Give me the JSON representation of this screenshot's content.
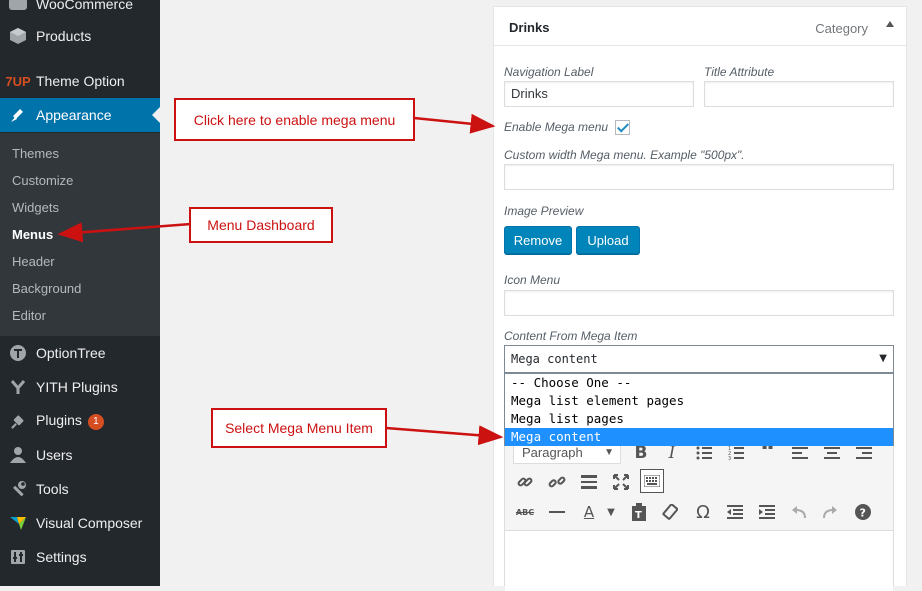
{
  "sidebar": {
    "items": [
      {
        "label": "WooCommerce",
        "icon": "woocommerce-icon"
      },
      {
        "label": "Products",
        "icon": "products-icon"
      },
      {
        "label": "Theme Option",
        "icon": "7up-logo-icon",
        "icon_text": "7UP"
      },
      {
        "label": "Appearance",
        "icon": "paintbrush-icon"
      },
      {
        "label": "OptionTree",
        "icon": "optiontree-icon"
      },
      {
        "label": "YITH Plugins",
        "icon": "yith-icon"
      },
      {
        "label": "Plugins",
        "icon": "plug-icon",
        "badge": "1"
      },
      {
        "label": "Users",
        "icon": "user-icon"
      },
      {
        "label": "Tools",
        "icon": "wrench-icon"
      },
      {
        "label": "Visual Composer",
        "icon": "visual-composer-icon"
      },
      {
        "label": "Settings",
        "icon": "sliders-icon"
      }
    ],
    "submenu": [
      "Themes",
      "Customize",
      "Widgets",
      "Menus",
      "Header",
      "Background",
      "Editor"
    ],
    "active_color": "#0073aa",
    "background": "#23282d"
  },
  "panel": {
    "title": "Drinks",
    "type": "Category",
    "nav_label_label": "Navigation Label",
    "nav_label_value": "Drinks",
    "title_attr_label": "Title Attribute",
    "title_attr_value": "",
    "enable_mega_label": "Enable Mega menu",
    "enable_mega_checked": true,
    "custom_width_label": "Custom width Mega menu. Example \"500px\".",
    "custom_width_value": "",
    "image_preview_label": "Image Preview",
    "remove_btn": "Remove",
    "upload_btn": "Upload",
    "icon_menu_label": "Icon Menu",
    "icon_menu_value": "",
    "content_label": "Content From Mega Item",
    "content_selected": "Mega content",
    "content_options": [
      "-- Choose One --",
      "Mega list element pages",
      "Mega list pages",
      "Mega content"
    ],
    "editor_format": "Paragraph"
  },
  "annotations": {
    "enable_mega": "Click here to enable mega menu",
    "menu_dashboard": "Menu Dashboard",
    "select_mega": "Select Mega Menu Item",
    "color": "#cc1111"
  }
}
